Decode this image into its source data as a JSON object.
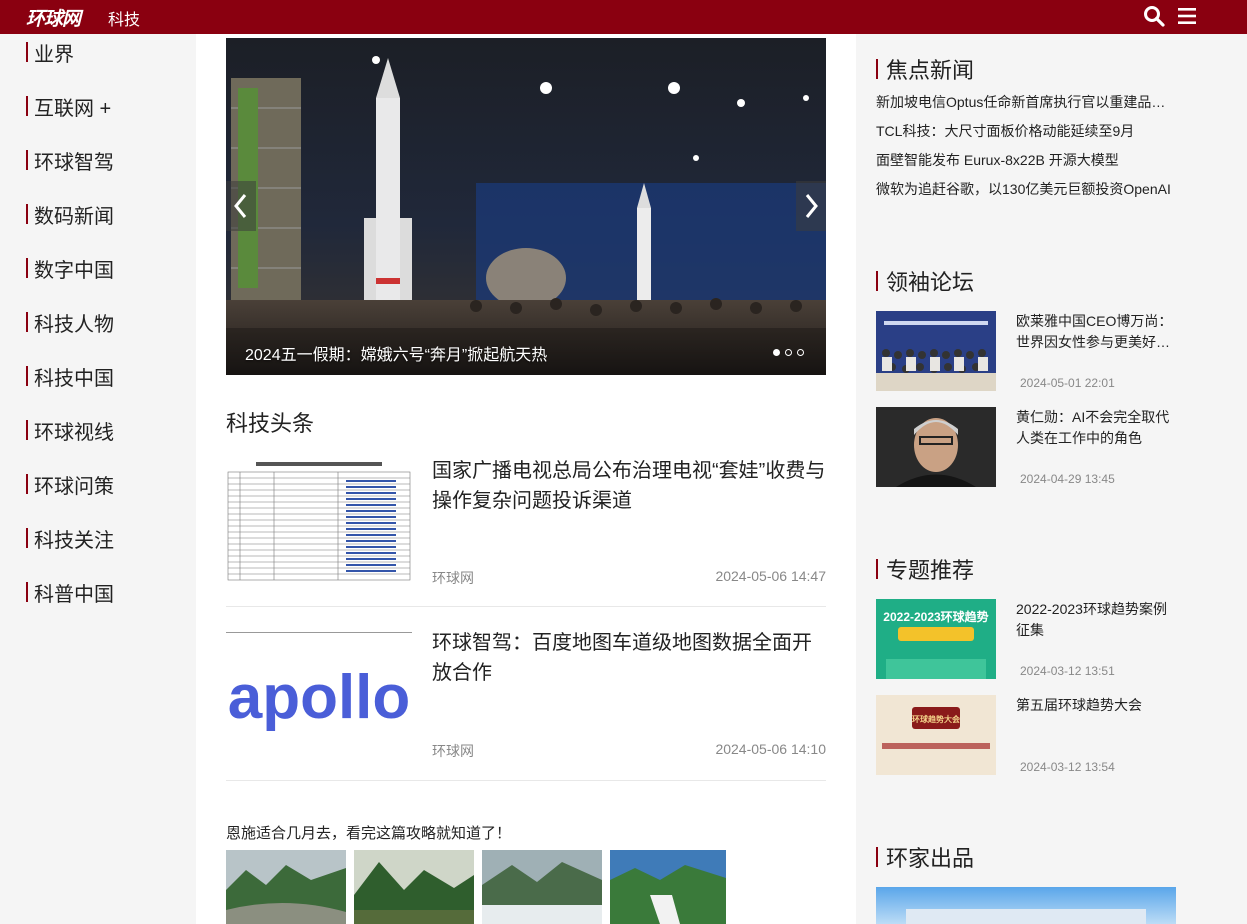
{
  "header": {
    "logo_text": "环球网",
    "channel": "科技"
  },
  "left_nav": {
    "items": [
      {
        "label": "业界"
      },
      {
        "label": "互联网 +"
      },
      {
        "label": "环球智驾"
      },
      {
        "label": "数码新闻"
      },
      {
        "label": "数字中国"
      },
      {
        "label": "科技人物"
      },
      {
        "label": "科技中国"
      },
      {
        "label": "环球视线"
      },
      {
        "label": "环球问策"
      },
      {
        "label": "科技关注"
      },
      {
        "label": "科普中国"
      }
    ]
  },
  "slider": {
    "caption": "2024五一假期：嫦娥六号“奔月”掀起航天热",
    "total_slides": 3,
    "active_slide": 1
  },
  "headlines": {
    "section_title": "科技头条",
    "items": [
      {
        "title": "国家广播电视总局公布治理电视“套娃”收费与操作复杂问题投诉渠道",
        "source": "环球网",
        "time": "2024-05-06 14:47"
      },
      {
        "title": "环球智驾：百度地图车道级地图数据全面开放合作",
        "source": "环球网",
        "time": "2024-05-06 14:10",
        "thumb_text": "apollo"
      }
    ]
  },
  "promo": {
    "text": "恩施适合几月去，看完这篇攻略就知道了！"
  },
  "focus_news": {
    "title": "焦点新闻",
    "items": [
      {
        "text": "新加坡电信Optus任命新首席执行官以重建品牌声誉"
      },
      {
        "text": "TCL科技：大尺寸面板价格动能延续至9月"
      },
      {
        "text": "面壁智能发布 Eurux-8x22B 开源大模型"
      },
      {
        "text": "微软为追赶谷歌，以130亿美元巨额投资OpenAI"
      }
    ]
  },
  "leaders_forum": {
    "title": "领袖论坛",
    "items": [
      {
        "title": "欧莱雅中国CEO博万尚：世界因女性参与更美好…",
        "time": "2024-05-01 22:01"
      },
      {
        "title": "黄仁勋：AI不会完全取代人类在工作中的角色",
        "time": "2024-04-29 13:45"
      }
    ]
  },
  "special_topics": {
    "title": "专题推荐",
    "items": [
      {
        "title": "2022-2023环球趋势案例征集",
        "time": "2024-03-12 13:51",
        "thumb_text": "2022-2023环球趋势"
      },
      {
        "title": "第五届环球趋势大会",
        "time": "2024-03-12 13:54",
        "thumb_text": "环球趋势大会"
      }
    ]
  },
  "huanjia": {
    "title": "环家出品"
  },
  "colors": {
    "brand_red": "#8a0010",
    "page_bg": "#f5f5f5"
  }
}
